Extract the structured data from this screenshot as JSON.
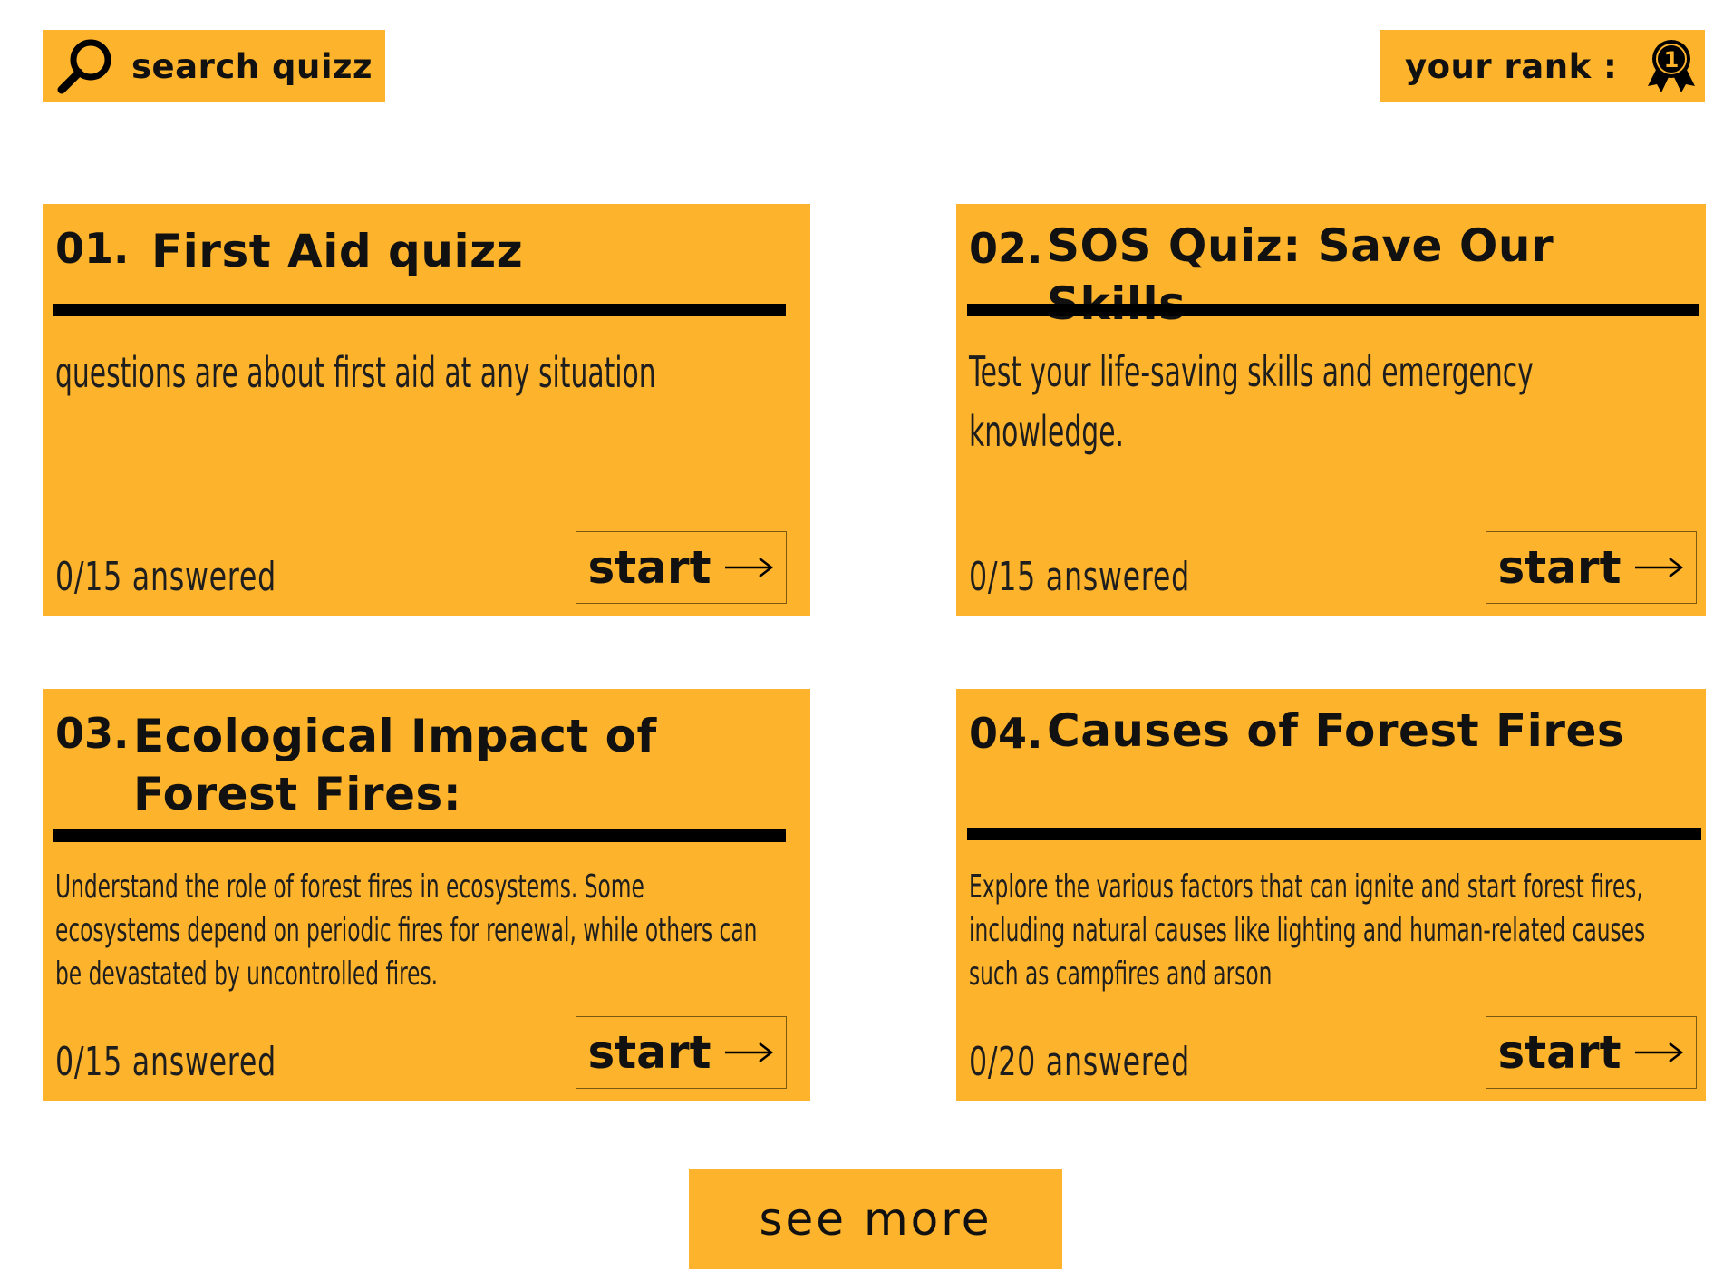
{
  "colors": {
    "accent": "#fdb32b",
    "text": "#111111",
    "rule": "#000000",
    "page_bg": "#ffffff"
  },
  "header": {
    "search_label": "search quizz",
    "search_icon": "search-icon",
    "rank_label": "your rank :",
    "rank_value": "1",
    "rank_icon": "medal-icon"
  },
  "quizzes": [
    {
      "number": "01.",
      "title": "First Aid quizz",
      "description": "questions are about first aid at any situation",
      "progress": "0/15 answered",
      "start_label": "start"
    },
    {
      "number": "02.",
      "title": "SOS Quiz: Save Our Skills",
      "description": "Test your life-saving skills and emergency knowledge.",
      "progress": "0/15 answered",
      "start_label": "start"
    },
    {
      "number": "03.",
      "title": "Ecological Impact of Forest Fires:",
      "description": "Understand the role of forest fires in ecosystems. Some ecosystems depend on periodic fires for renewal, while others can be devastated by uncontrolled fires.",
      "progress": "0/15 answered",
      "start_label": "start"
    },
    {
      "number": "04.",
      "title": "Causes of Forest Fires",
      "description": "Explore the various factors that can ignite and start forest fires, including natural causes like lighting and human-related causes such  as campfires and arson",
      "progress": "0/20 answered",
      "start_label": "start"
    }
  ],
  "footer": {
    "see_more_label": "see more"
  }
}
